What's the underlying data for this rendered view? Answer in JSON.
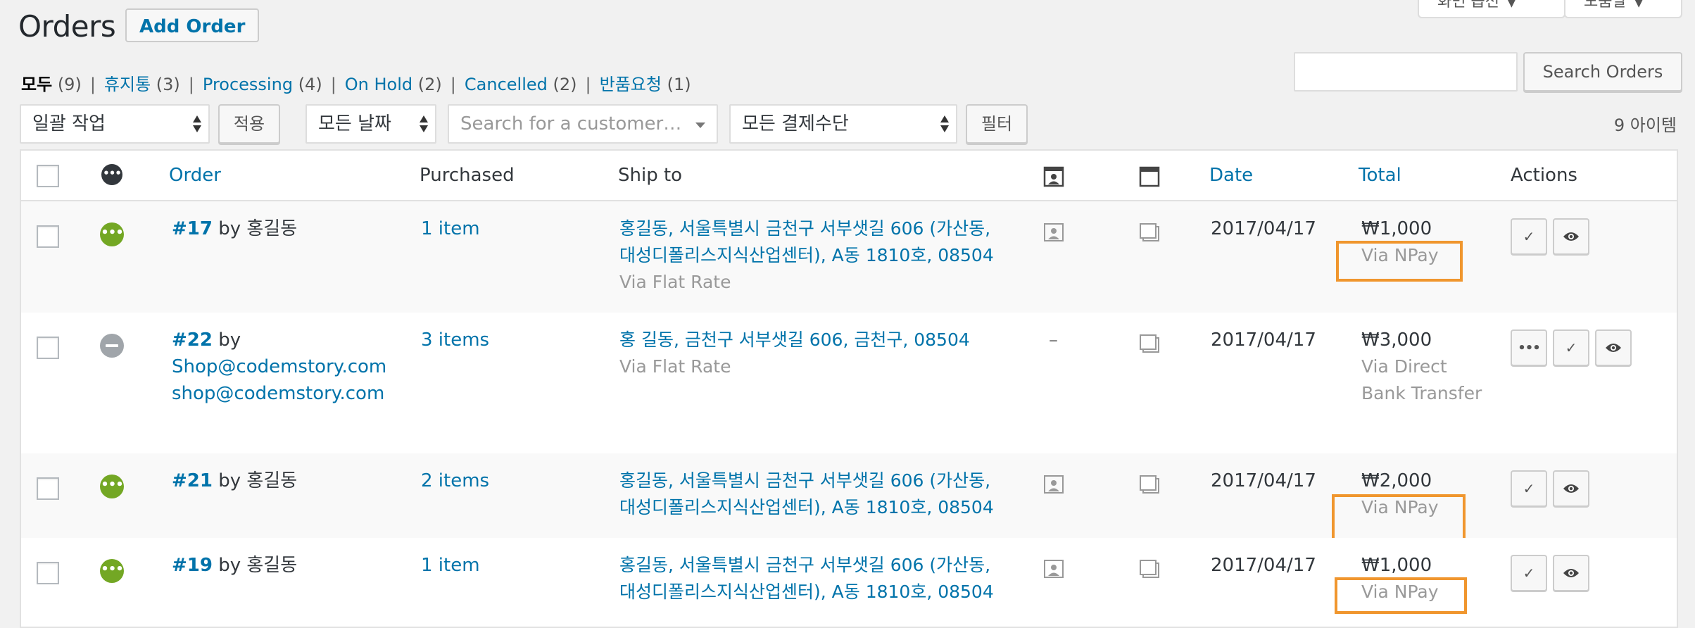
{
  "header": {
    "title": "Orders",
    "add_order_label": "Add Order",
    "screen_options_label": "화면 옵션",
    "help_label": "도움말"
  },
  "views": [
    {
      "label": "모두",
      "count": "(9)",
      "current": true
    },
    {
      "label": "휴지통",
      "count": "(3)"
    },
    {
      "label": "Processing",
      "count": "(4)"
    },
    {
      "label": "On Hold",
      "count": "(2)"
    },
    {
      "label": "Cancelled",
      "count": "(2)"
    },
    {
      "label": "반품요청",
      "count": "(1)"
    }
  ],
  "search": {
    "value": "",
    "button_label": "Search Orders"
  },
  "tablenav": {
    "bulk_action": "일괄 작업",
    "apply_label": "적용",
    "date_filter": "모든 날짜",
    "customer_placeholder": "Search for a customer…",
    "payment_filter": "모든 결제수단",
    "filter_label": "필터",
    "item_count": "9 아이템"
  },
  "columns": {
    "order": "Order",
    "purchased": "Purchased",
    "ship_to": "Ship to",
    "date": "Date",
    "total": "Total",
    "actions": "Actions"
  },
  "orders": [
    {
      "number": "#17",
      "by": "by 홍길동",
      "by_email": "",
      "email": "",
      "purchased": "1 item",
      "ship_line1": "홍길동, 서울특별시 금천구 서부샛길 606 (가산동,",
      "ship_line2": "대성디폴리스지식산업센터), A동 1810호, 08504",
      "ship_via": "Via Flat Rate",
      "customer_note": "",
      "date": "2017/04/17",
      "total": "₩1,000",
      "payment_line1": "Via NPay",
      "payment_line2": "",
      "status": "processing"
    },
    {
      "number": "#22",
      "by": "by",
      "by_email": "Shop@codemstory.com",
      "email": "shop@codemstory.com",
      "purchased": "3 items",
      "ship_line1": "홍 길동, 금천구 서부샛길 606, 금천구, 08504",
      "ship_line2": "",
      "ship_via": "Via Flat Rate",
      "customer_note": "–",
      "date": "2017/04/17",
      "total": "₩3,000",
      "payment_line1": "Via Direct",
      "payment_line2": "Bank Transfer",
      "status": "cancelled"
    },
    {
      "number": "#21",
      "by": "by 홍길동",
      "by_email": "",
      "email": "",
      "purchased": "2 items",
      "ship_line1": "홍길동, 서울특별시 금천구 서부샛길 606 (가산동,",
      "ship_line2": "대성디폴리스지식산업센터), A동 1810호, 08504",
      "ship_via": "",
      "customer_note": "",
      "date": "2017/04/17",
      "total": "₩2,000",
      "payment_line1": "Via NPay",
      "payment_line2": "",
      "status": "processing"
    },
    {
      "number": "#19",
      "by": "by 홍길동",
      "by_email": "",
      "email": "",
      "purchased": "1 item",
      "ship_line1": "홍길동, 서울특별시 금천구 서부샛길 606 (가산동,",
      "ship_line2": "대성디폴리스지식산업센터), A동 1810호, 08504",
      "ship_via": "",
      "customer_note": "",
      "date": "2017/04/17",
      "total": "₩1,000",
      "payment_line1": "Via NPay",
      "payment_line2": "",
      "status": "processing"
    }
  ],
  "colors": {
    "link": "#0073aa",
    "processing": "#73a724",
    "cancelled": "#a0a5aa",
    "highlight": "#f0962e"
  },
  "icons": {
    "status_processing": "ellipsis-circle-icon",
    "status_cancelled": "minus-circle-icon",
    "customer_message": "customer-message-icon",
    "order_notes": "window-icon",
    "complete": "checkmark-icon",
    "view": "eye-icon",
    "processing_action": "ellipsis-icon"
  }
}
